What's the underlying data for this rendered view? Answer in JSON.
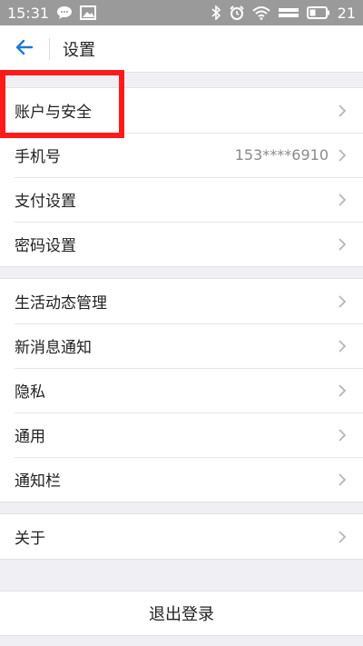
{
  "status_bar": {
    "time": "15:31",
    "battery_level": "21",
    "icons_left": [
      "message-icon",
      "image-icon"
    ],
    "icons_right": [
      "bluetooth-icon",
      "alarm-icon",
      "wifi-icon",
      "data-speed-icon",
      "battery-icon"
    ]
  },
  "header": {
    "title": "设置",
    "back_icon": "arrow-left-icon",
    "accent": "#1a7ad8"
  },
  "groups": [
    {
      "items": [
        {
          "label": "账户与安全"
        },
        {
          "label": "手机号",
          "value": "153****6910"
        },
        {
          "label": "支付设置"
        },
        {
          "label": "密码设置"
        }
      ]
    },
    {
      "items": [
        {
          "label": "生活动态管理"
        },
        {
          "label": "新消息通知"
        },
        {
          "label": "隐私"
        },
        {
          "label": "通用"
        },
        {
          "label": "通知栏"
        }
      ]
    },
    {
      "items": [
        {
          "label": "关于"
        }
      ]
    }
  ],
  "logout_label": "退出登录",
  "highlight_color": "#ff1a1a"
}
